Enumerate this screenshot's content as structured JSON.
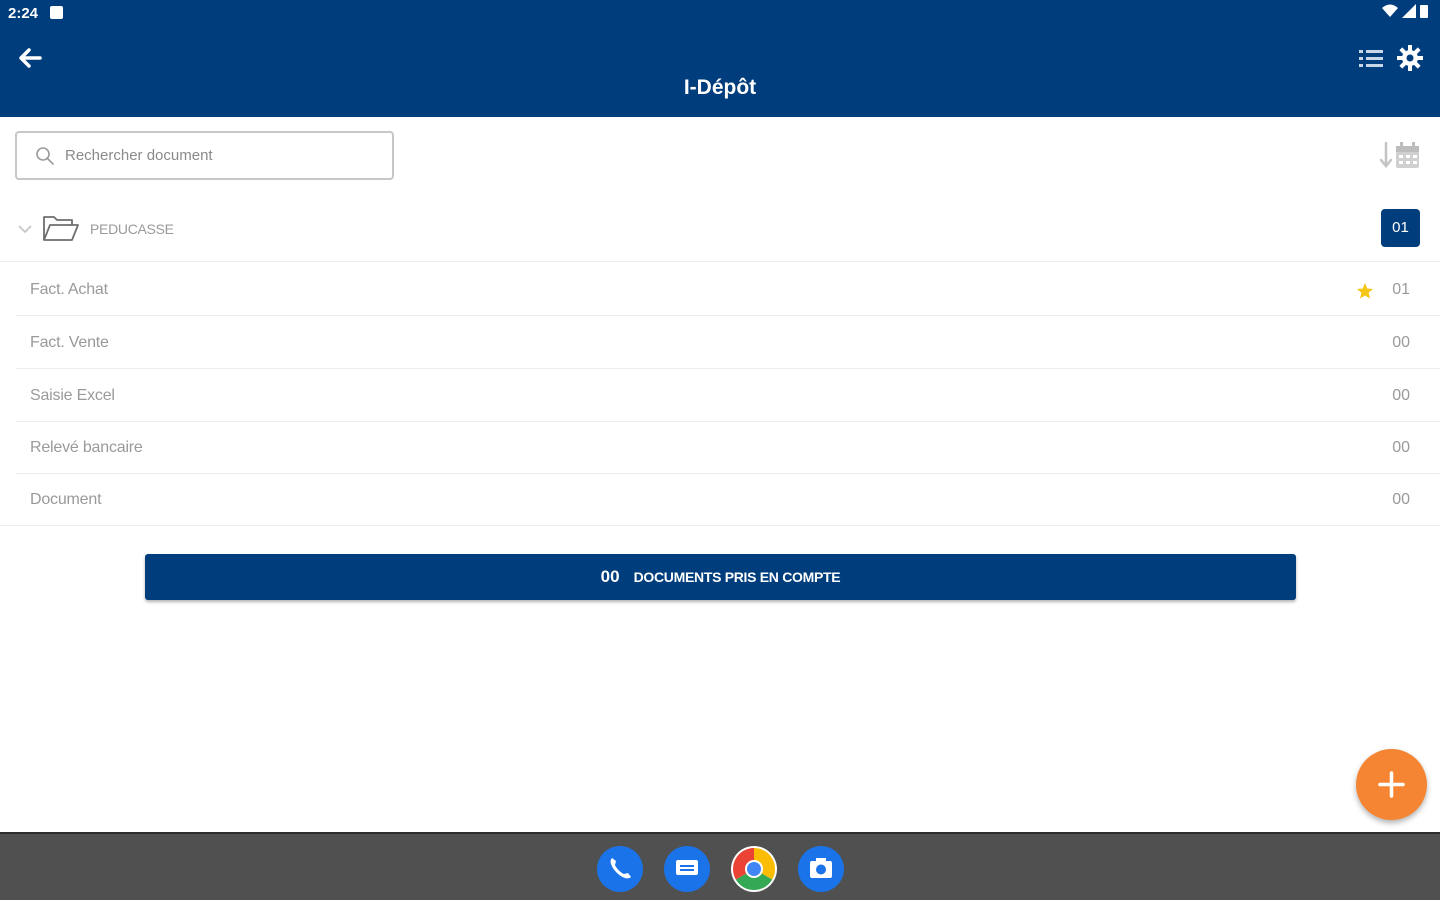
{
  "status_bar": {
    "time": "2:24"
  },
  "app_bar": {
    "title": "I-Dépôt"
  },
  "search": {
    "placeholder": "Rechercher document"
  },
  "folder": {
    "name": "PEDUCASSE",
    "count": "01"
  },
  "categories": [
    {
      "label": "Fact. Achat",
      "count": "01",
      "starred": true
    },
    {
      "label": "Fact. Vente",
      "count": "00",
      "starred": false
    },
    {
      "label": "Saisie Excel",
      "count": "00",
      "starred": false
    },
    {
      "label": "Relevé bancaire",
      "count": "00",
      "starred": false
    },
    {
      "label": "Document",
      "count": "00",
      "starred": false
    }
  ],
  "summary": {
    "count": "00",
    "label": "DOCUMENTS PRIS EN COMPTE"
  },
  "colors": {
    "primary": "#003d7c",
    "accent": "#f58532",
    "star": "#f5c518",
    "muted_text": "#9a9a9a"
  },
  "dock": [
    "phone-icon",
    "messages-icon",
    "chrome-icon",
    "camera-icon"
  ]
}
